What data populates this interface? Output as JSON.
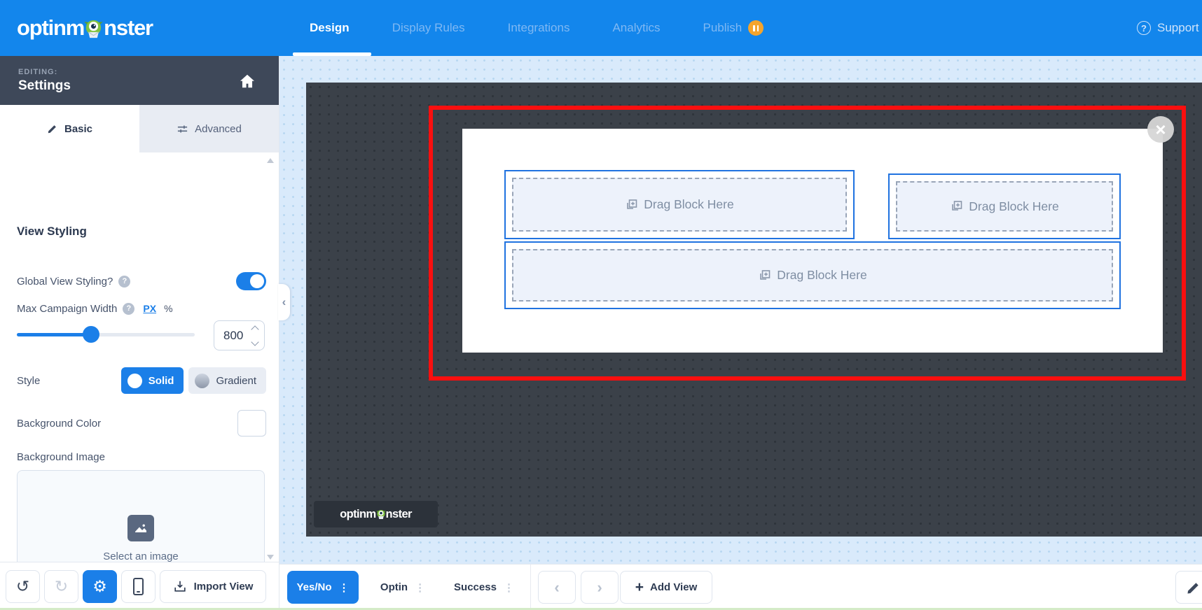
{
  "nav": {
    "brand_pre": "optinm",
    "brand_post": "nster",
    "tabs": [
      {
        "label": "Design",
        "active": true
      },
      {
        "label": "Display Rules",
        "active": false
      },
      {
        "label": "Integrations",
        "active": false
      },
      {
        "label": "Analytics",
        "active": false
      },
      {
        "label": "Publish",
        "active": false,
        "status": "paused"
      }
    ],
    "support_label": "Support"
  },
  "sidebar": {
    "editing_label": "EDITING:",
    "view_title": "Settings",
    "tabs": [
      {
        "label": "Basic",
        "active": true
      },
      {
        "label": "Advanced",
        "active": false
      }
    ],
    "section_heading": "View Styling",
    "global_view_styling": {
      "label": "Global View Styling?",
      "enabled": true
    },
    "max_campaign_width": {
      "label": "Max Campaign Width",
      "unit_px": "PX",
      "unit_percent": "%",
      "value": "800"
    },
    "style": {
      "label": "Style",
      "options": [
        {
          "label": "Solid",
          "active": true
        },
        {
          "label": "Gradient",
          "active": false
        }
      ]
    },
    "background_color_label": "Background Color",
    "background_image": {
      "label": "Background Image",
      "placeholder": "Select an image"
    },
    "toolbar": {
      "import_view_label": "Import View"
    }
  },
  "canvas": {
    "dropzones": [
      {
        "label": "Drag Block Here"
      },
      {
        "label": "Drag Block Here"
      },
      {
        "label": "Drag Block Here"
      }
    ],
    "badge_brand_pre": "optinm",
    "badge_brand_post": "nster"
  },
  "bottombar": {
    "views": [
      {
        "label": "Yes/No",
        "active": true
      },
      {
        "label": "Optin",
        "active": false
      },
      {
        "label": "Success",
        "active": false
      }
    ],
    "add_view_label": "Add View"
  },
  "icons": {
    "close": "×",
    "chevron_left": "‹",
    "chevron_right": "›",
    "collapse": "‹",
    "kebab": "⋮",
    "plus": "+",
    "help": "?",
    "undo": "↺",
    "redo": "↻",
    "gear": "⚙"
  },
  "colors": {
    "accent_blue": "#1b7fe8",
    "nav_blue": "#1386ec",
    "canvas_dark": "#3b4149",
    "red_outline": "#fa0f0f",
    "dropzone_border": "#1f72e0",
    "pause_badge": "#f4a42c",
    "page_bg": "#d9eafb"
  }
}
